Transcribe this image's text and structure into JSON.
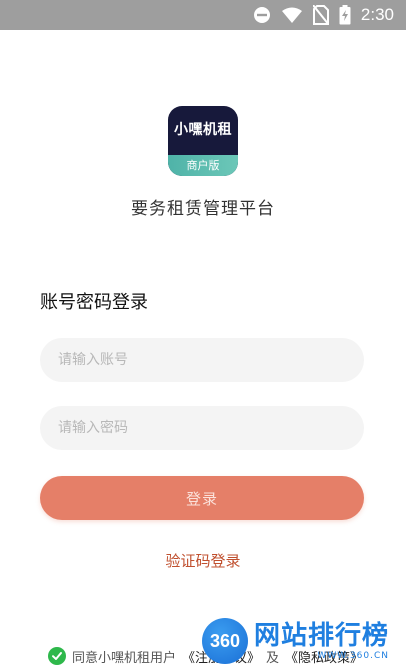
{
  "status_bar": {
    "time": "2:30",
    "icons": [
      "do-not-disturb-icon",
      "wifi-icon",
      "no-sim-icon",
      "battery-charging-icon"
    ]
  },
  "logo": {
    "name": "小嘿机租",
    "badge": "商户版"
  },
  "platform_title": "要务租赁管理平台",
  "login": {
    "section_title": "账号密码登录",
    "account_placeholder": "请输入账号",
    "password_placeholder": "请输入密码",
    "login_button": "登录",
    "code_login_link": "验证码登录"
  },
  "agreement": {
    "prefix": "同意小嘿机租用户",
    "terms_link": "《注册协议》",
    "and": "及",
    "privacy_link": "《隐私政策》",
    "checked": true
  },
  "watermark": {
    "circle_text": "360",
    "title": "网站排行榜",
    "subtitle": "WWW.360.CN"
  },
  "colors": {
    "accent": "#e57f68",
    "link": "#c0502f",
    "check": "#2eb84b"
  }
}
